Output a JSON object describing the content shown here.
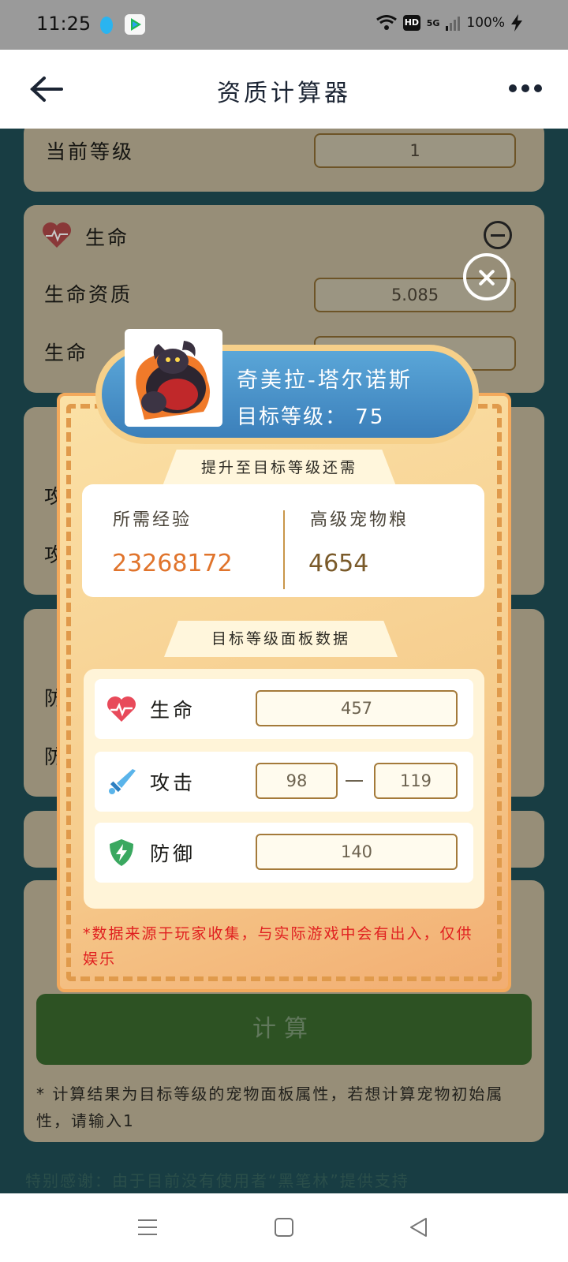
{
  "status_bar": {
    "time": "11:25",
    "network": "5G",
    "battery": "100%",
    "hd": "HD"
  },
  "header": {
    "title": "资质计算器"
  },
  "background": {
    "current_level_label": "当前等级",
    "current_level_value": "1",
    "life_section_title": "生命",
    "life_aptitude_label": "生命资质",
    "life_aptitude_value": "5.085",
    "life_label": "生命",
    "attack_label_partial_1": "攻",
    "attack_label_partial_2": "攻",
    "defense_label_partial_1": "防",
    "defense_label_partial_2": "防",
    "compute_button": "计算",
    "footnote": "* 计算结果为目标等级的宠物面板属性，若想计算宠物初始属性，请输入1",
    "bottom_note": "特别感谢：由于目前没有使用者“黑笔林”提供支持"
  },
  "modal": {
    "pet_name": "奇美拉-塔尔诺斯",
    "target_level_label": "目标等级：",
    "target_level_value": "75",
    "requirements_tab": "提升至目标等级还需",
    "exp_label": "所需经验",
    "exp_value": "23268172",
    "food_label": "高级宠物粮",
    "food_value": "4654",
    "panel_tab": "目标等级面板数据",
    "life_label": "生命",
    "life_value": "457",
    "attack_label": "攻击",
    "attack_min": "98",
    "attack_max": "119",
    "defense_label": "防御",
    "defense_value": "140",
    "disclaimer": "*数据来源于玩家收集，与实际游戏中会有出入，仅供娱乐"
  },
  "colors": {
    "accent_orange": "#e0742c",
    "value_brown": "#7a5a2a",
    "disclaimer_red": "#e02020",
    "banner_blue": "#3b7fba"
  }
}
